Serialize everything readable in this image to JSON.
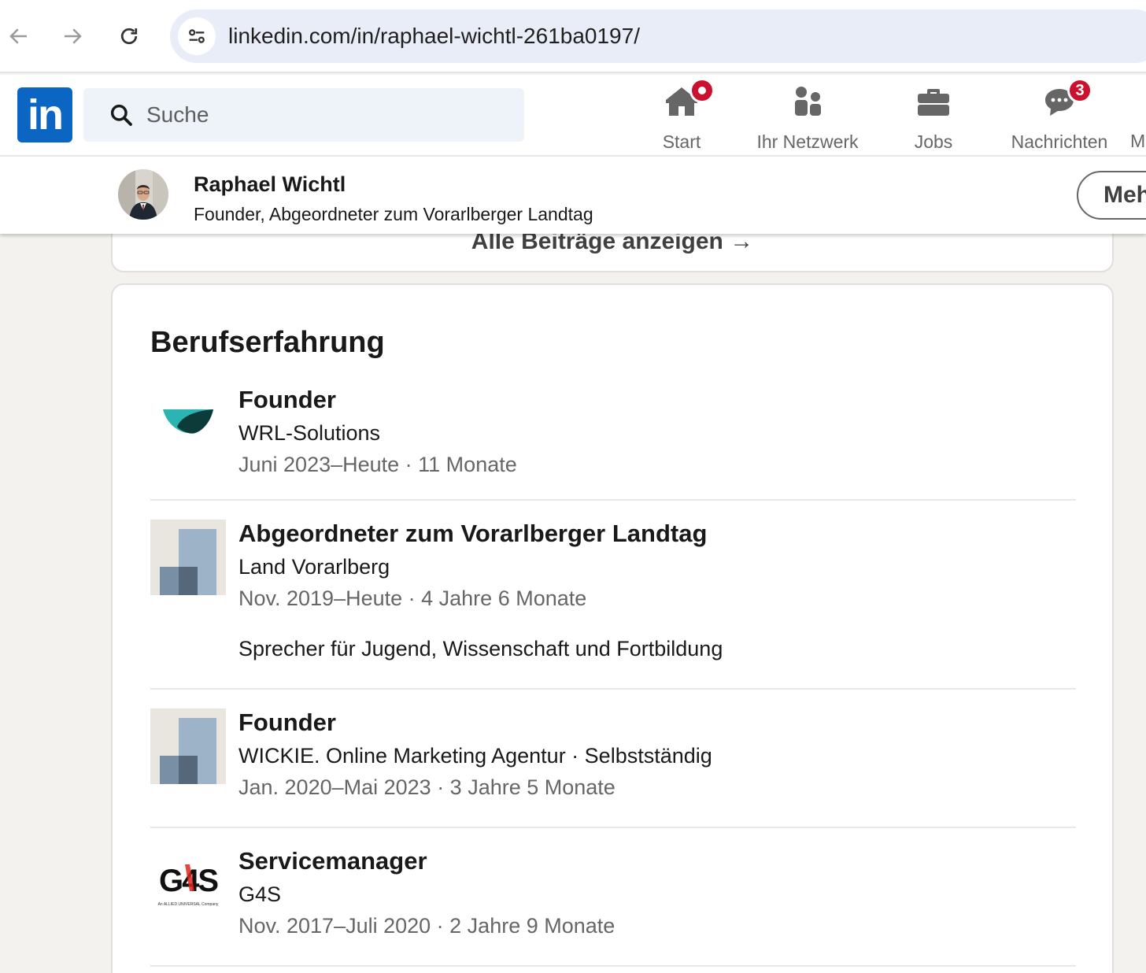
{
  "browser": {
    "url": "linkedin.com/in/raphael-wichtl-261ba0197/"
  },
  "nav": {
    "logo_text": "in",
    "search_placeholder": "Suche",
    "items": [
      {
        "label": "Start",
        "icon": "home-icon",
        "badge": "dot"
      },
      {
        "label": "Ihr Netzwerk",
        "icon": "network-icon"
      },
      {
        "label": "Jobs",
        "icon": "briefcase-icon"
      },
      {
        "label": "Nachrichten",
        "icon": "messaging-icon",
        "badge": "3"
      },
      {
        "label": "M"
      }
    ]
  },
  "profile_bar": {
    "name": "Raphael Wichtl",
    "headline": "Founder, Abgeordneter zum Vorarlberger Landtag",
    "more_label": "Meh"
  },
  "prev_section": {
    "show_all_label": "Alle Beiträge anzeigen →"
  },
  "experience": {
    "title": "Berufserfahrung",
    "entries": [
      {
        "role": "Founder",
        "company": "WRL-Solutions",
        "period": "Juni 2023–Heute · 11 Monate",
        "logo": "wrl-logo"
      },
      {
        "role": "Abgeordneter zum Vorarlberger Landtag",
        "company": "Land Vorarlberg",
        "period": "Nov. 2019–Heute · 4 Jahre 6 Monate",
        "description": "Sprecher für Jugend, Wissenschaft und Fortbildung",
        "logo": "placeholder-company-logo"
      },
      {
        "role": "Founder",
        "company": "WICKIE. Online Marketing Agentur · Selbstständig",
        "period": "Jan. 2020–Mai 2023 · 3 Jahre 5 Monate",
        "logo": "placeholder-company-logo"
      },
      {
        "role": "Servicemanager",
        "company": "G4S",
        "period": "Nov. 2017–Juli 2020 · 2 Jahre 9 Monate",
        "logo": "g4s-logo",
        "logo_text": "G4S",
        "logo_subtext": "An ALLIED UNIVERSAL Company"
      }
    ]
  },
  "colors": {
    "brand": "#0a66c2",
    "badge": "#cb112d",
    "page_bg": "#f4f2ee"
  }
}
